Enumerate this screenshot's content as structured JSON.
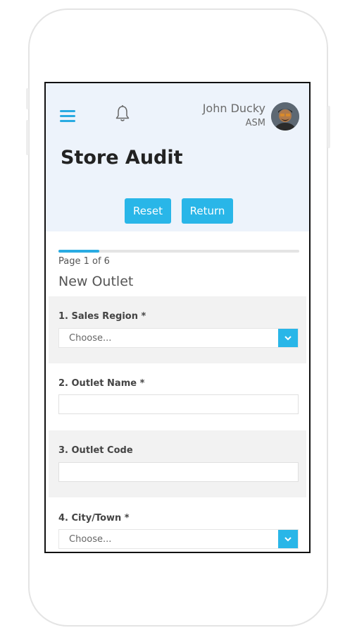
{
  "header": {
    "user_name": "John Ducky",
    "user_role": "ASM",
    "page_title": "Store Audit"
  },
  "actions": {
    "reset_label": "Reset",
    "return_label": "Return"
  },
  "progress": {
    "fraction": 0.17,
    "page_text": "Page 1 of 6"
  },
  "section_title": "New Outlet",
  "questions": [
    {
      "label": "1. Sales Region *",
      "type": "select",
      "placeholder": "Choose..."
    },
    {
      "label": "2. Outlet Name *",
      "type": "text",
      "value": ""
    },
    {
      "label": "3. Outlet Code",
      "type": "text",
      "value": ""
    },
    {
      "label": "4. City/Town *",
      "type": "select",
      "placeholder": "Choose..."
    }
  ],
  "icons": {
    "menu": "hamburger-menu-icon",
    "notifications": "bell-icon",
    "dropdown": "chevron-down-icon"
  },
  "colors": {
    "accent": "#29b6e8",
    "header_bg": "#edf3fb",
    "alt_row_bg": "#f2f2f2"
  }
}
